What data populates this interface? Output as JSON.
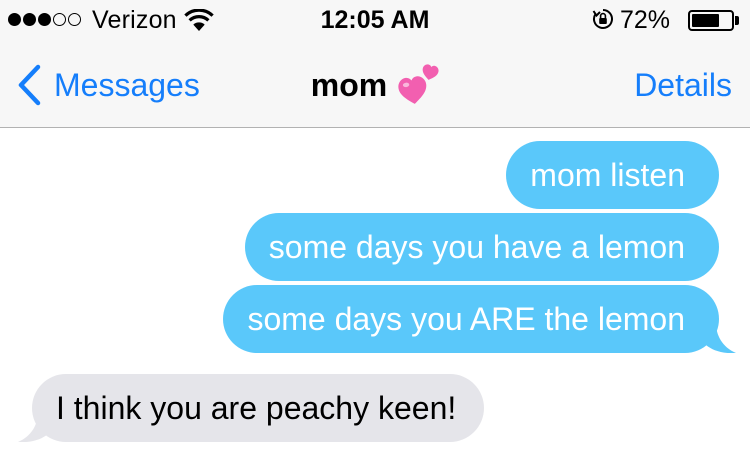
{
  "status_bar": {
    "carrier": "Verizon",
    "signal_bars_filled": 3,
    "signal_bars_total": 5,
    "time": "12:05 AM",
    "battery_percent_label": "72%",
    "battery_level": 0.72,
    "icons": [
      "signal-dots-icon",
      "wifi-icon",
      "rotation-lock-icon",
      "battery-icon"
    ]
  },
  "nav": {
    "back_label": "Messages",
    "title": "mom",
    "title_emoji": "heart-icon",
    "details_label": "Details"
  },
  "messages": [
    {
      "direction": "outgoing",
      "text": "mom listen"
    },
    {
      "direction": "outgoing",
      "text": "some days you have a lemon"
    },
    {
      "direction": "outgoing",
      "text": "some days you ARE the lemon"
    },
    {
      "direction": "incoming",
      "text": "I think you are peachy keen!"
    }
  ],
  "colors": {
    "ios_blue": "#157efb",
    "outgoing_bubble": "#5ac8fa",
    "incoming_bubble": "#e5e5ea",
    "nav_background": "#f7f7f7",
    "emoji_pink": "#f25fb0"
  }
}
